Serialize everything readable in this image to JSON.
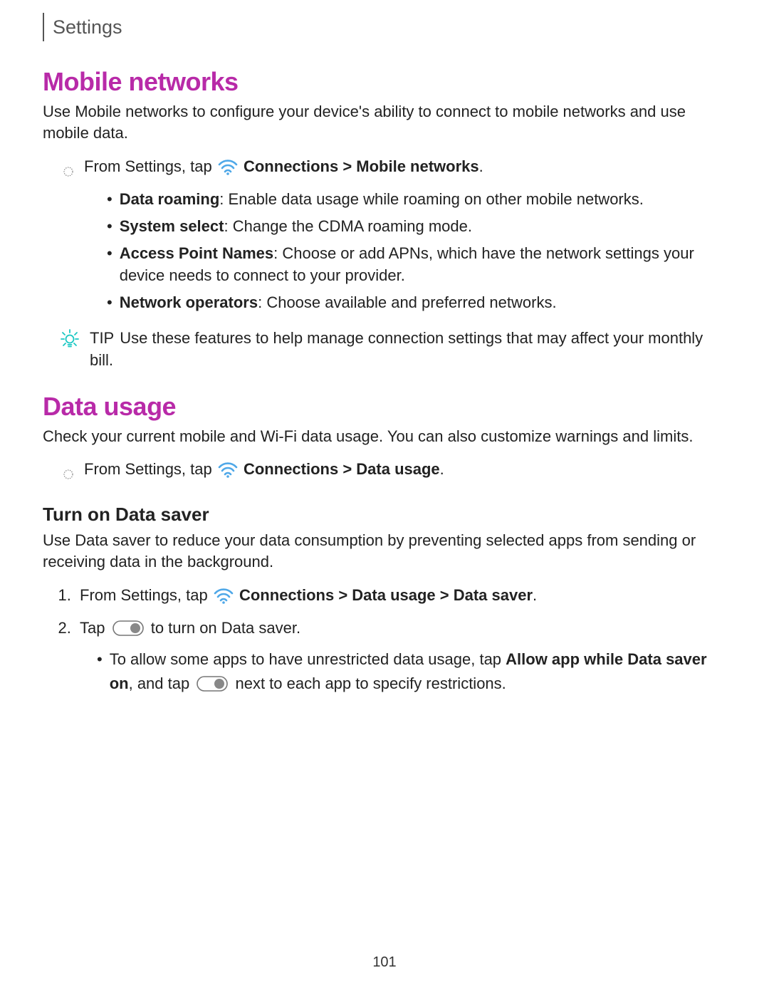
{
  "header": {
    "title": "Settings"
  },
  "section1": {
    "heading": "Mobile networks",
    "intro": "Use Mobile networks to configure your device's ability to connect to mobile networks and use mobile data.",
    "step": {
      "prefix": "From Settings, tap ",
      "path_bold": "Connections > Mobile networks",
      "suffix": "."
    },
    "bullets": [
      {
        "label": "Data roaming",
        "text": ": Enable data usage while roaming on other mobile networks."
      },
      {
        "label": "System select",
        "text": ": Change the CDMA roaming mode."
      },
      {
        "label": "Access Point Names",
        "text": ": Choose or add APNs, which have the network settings your device needs to connect to your provider."
      },
      {
        "label": "Network operators",
        "text": ": Choose available and preferred networks."
      }
    ],
    "tip": {
      "label": "TIP",
      "text": "Use these features to help manage connection settings that may affect your monthly bill."
    }
  },
  "section2": {
    "heading": "Data usage",
    "intro": "Check your current mobile and Wi-Fi data usage. You can also customize warnings and limits.",
    "step": {
      "prefix": "From Settings, tap ",
      "path_bold": "Connections > Data usage",
      "suffix": "."
    },
    "sub": {
      "heading": "Turn on Data saver",
      "intro": "Use Data saver to reduce your data consumption by preventing selected apps from sending or receiving data in the background.",
      "ol1": {
        "prefix": "From Settings, tap ",
        "path_bold": "Connections > Data usage > Data saver",
        "suffix": "."
      },
      "ol2": {
        "prefix": "Tap ",
        "suffix": " to turn on Data saver."
      },
      "subbullet": {
        "pre": "To allow some apps to have unrestricted data usage, tap ",
        "bold1": "Allow app while Data saver on",
        "mid": ", and tap ",
        "post": " next to each app to specify restrictions."
      }
    }
  },
  "pageNumber": "101"
}
